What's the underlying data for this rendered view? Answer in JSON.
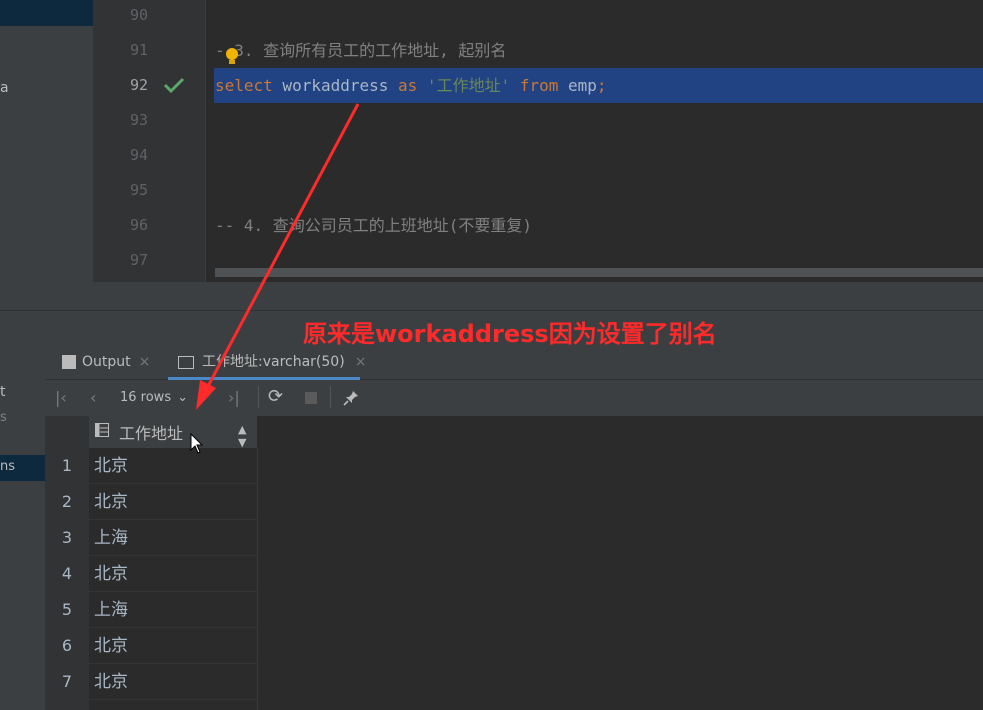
{
  "editor": {
    "line_numbers": [
      "90",
      "91",
      "92",
      "93",
      "94",
      "95",
      "96",
      "97"
    ],
    "current_line": "92",
    "comment_3": "- 3. 查询所有员工的工作地址, 起别名",
    "code_line": {
      "kw_select": "select",
      "col": " workaddress ",
      "kw_as": "as",
      "alias": " '工作地址' ",
      "kw_from": "from",
      "table": " emp",
      "semi": ";"
    },
    "comment_4": "-- 4. 查询公司员工的上班地址(不要重复)"
  },
  "left_strip": {
    "truncated_label": "a"
  },
  "bottom_left": {
    "label_a": "t",
    "label_b": "s",
    "label_c": "ns"
  },
  "tabs": [
    {
      "label": "Output"
    },
    {
      "label": "工作地址:varchar(50)"
    }
  ],
  "toolbar": {
    "rows": "16 rows"
  },
  "grid": {
    "column": "工作地址",
    "rows": [
      {
        "n": "1",
        "v": "北京"
      },
      {
        "n": "2",
        "v": "北京"
      },
      {
        "n": "3",
        "v": "上海"
      },
      {
        "n": "4",
        "v": "北京"
      },
      {
        "n": "5",
        "v": "上海"
      },
      {
        "n": "6",
        "v": "北京"
      },
      {
        "n": "7",
        "v": "北京"
      }
    ]
  },
  "annotation": {
    "text": "原来是workaddress因为设置了别名",
    "color": "#ff2a2a"
  },
  "colors": {
    "keyword": "#cc7832",
    "string": "#6a8759",
    "selection": "#214283",
    "comment": "#808080"
  }
}
